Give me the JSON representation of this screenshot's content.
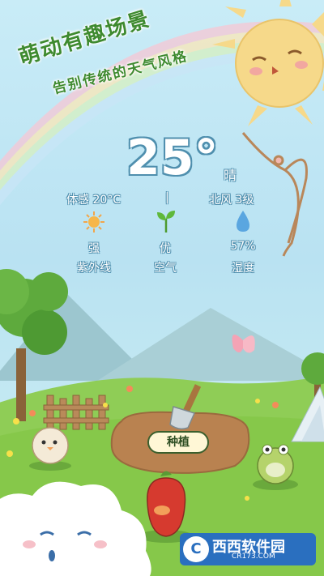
{
  "promo": {
    "headline": "萌动有趣场景",
    "subline": "告别传统的天气风格"
  },
  "weather": {
    "temperature": "25°",
    "condition": "晴",
    "feels_like": "体感 20°C",
    "separator": "|",
    "wind": "北风 3级"
  },
  "metrics": [
    {
      "icon": "sun-icon",
      "value": "强",
      "label": "紫外线"
    },
    {
      "icon": "sprout-icon",
      "value": "优",
      "label": "空气"
    },
    {
      "icon": "water-drop-icon",
      "value": "57%",
      "label": "湿度"
    }
  ],
  "garden": {
    "plant_button": "种植"
  },
  "watermark": {
    "logo_text": "C",
    "brand": "西西软件园",
    "url": "CR173.COM"
  },
  "colors": {
    "sky": "#bfe3f3",
    "grass": "#86c84a",
    "text_outline": "#4f8fae",
    "promo_text": "#3e8a2f"
  }
}
